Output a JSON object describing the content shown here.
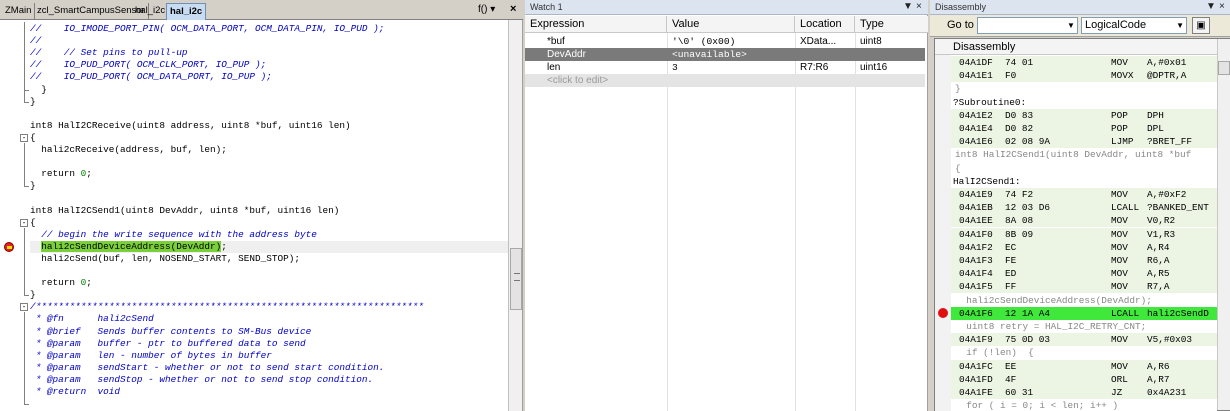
{
  "editor": {
    "tabs": [
      "ZMain",
      "zcl_SmartCampusSensor",
      "hal_i2c",
      "hal_i2c"
    ],
    "active_tab_index": 3,
    "func_button": "f()",
    "close": "×",
    "lines": [
      {
        "text": "//    IO_IMODE_PORT_PIN( OCM_DATA_PORT, OCM_DATA_PIN, IO_PUD );",
        "style": "comment"
      },
      {
        "text": "//",
        "style": "comment"
      },
      {
        "text": "//    // Set pins to pull-up",
        "style": "comment"
      },
      {
        "text": "//    IO_PUD_PORT( OCM_CLK_PORT, IO_PUP );",
        "style": "comment"
      },
      {
        "text": "//    IO_PUD_PORT( OCM_DATA_PORT, IO_PUP );",
        "style": "comment"
      },
      {
        "text": "  }",
        "style": "code"
      },
      {
        "text": "}",
        "style": "code"
      },
      {
        "text": "",
        "style": "code"
      },
      {
        "text": "int8 HalI2CReceive(uint8 address, uint8 *buf, uint16 len)",
        "style": "code"
      },
      {
        "text": "{",
        "style": "code"
      },
      {
        "text": "  hali2cReceive(address, buf, len);",
        "style": "code"
      },
      {
        "text": "",
        "style": "code"
      },
      {
        "text": "  return 0;",
        "style": "ret"
      },
      {
        "text": "}",
        "style": "code"
      },
      {
        "text": "",
        "style": "code"
      },
      {
        "text": "int8 HalI2CSend1(uint8 DevAddr, uint8 *buf, uint16 len)",
        "style": "code"
      },
      {
        "text": "{",
        "style": "code"
      },
      {
        "text": "  // begin the write sequence with the address byte",
        "style": "comment"
      },
      {
        "text": "  hali2cSendDeviceAddress(DevAddr);",
        "style": "highlight"
      },
      {
        "text": "  hali2cSend(buf, len, NOSEND_START, SEND_STOP);",
        "style": "code"
      },
      {
        "text": "",
        "style": "code"
      },
      {
        "text": "  return 0;",
        "style": "ret"
      },
      {
        "text": "}",
        "style": "code"
      },
      {
        "text": "/*********************************************************************",
        "style": "comment"
      },
      {
        "text": " * @fn      hali2cSend",
        "style": "comment"
      },
      {
        "text": " * @brief   Sends buffer contents to SM-Bus device",
        "style": "comment"
      },
      {
        "text": " * @param   buffer - ptr to buffered data to send",
        "style": "comment"
      },
      {
        "text": " * @param   len - number of bytes in buffer",
        "style": "comment"
      },
      {
        "text": " * @param   sendStart - whether or not to send start condition.",
        "style": "comment"
      },
      {
        "text": " * @param   sendStop - whether or not to send stop condition.",
        "style": "comment"
      },
      {
        "text": " * @return  void",
        "style": "comment"
      }
    ]
  },
  "watch": {
    "title": "Watch 1",
    "pin": "▼",
    "close": "×",
    "columns": [
      "Expression",
      "Value",
      "Location",
      "Type"
    ],
    "rows": [
      {
        "expr": "*buf",
        "value": "'\\0' (0x00)",
        "location": "XData...",
        "type": "uint8",
        "state": "normal"
      },
      {
        "expr": "DevAddr",
        "value": "<unavailable>",
        "location": "",
        "type": "",
        "state": "selected"
      },
      {
        "expr": "len",
        "value": "3",
        "location": "R7:R6",
        "type": "uint16",
        "state": "normal"
      },
      {
        "expr": "<click to edit>",
        "value": "",
        "location": "",
        "type": "",
        "state": "add"
      }
    ]
  },
  "disassembly": {
    "title": "Disassembly",
    "pin": "▼",
    "close": "×",
    "goto_label": "Go to",
    "goto_value": "",
    "mode": "LogicalCode",
    "header": "Disassembly",
    "lines": [
      {
        "kind": "asm",
        "addr": "04A1DF",
        "bytes": "74 01",
        "op": "MOV",
        "args": "A,#0x01"
      },
      {
        "kind": "asm",
        "addr": "04A1E1",
        "bytes": "F0",
        "op": "MOVX",
        "args": "@DPTR,A"
      },
      {
        "kind": "src",
        "text": "}"
      },
      {
        "kind": "lbl",
        "text": "?Subroutine0:"
      },
      {
        "kind": "asm",
        "addr": "04A1E2",
        "bytes": "D0 83",
        "op": "POP",
        "args": "DPH"
      },
      {
        "kind": "asm",
        "addr": "04A1E4",
        "bytes": "D0 82",
        "op": "POP",
        "args": "DPL"
      },
      {
        "kind": "asm",
        "addr": "04A1E6",
        "bytes": "02 08 9A",
        "op": "LJMP",
        "args": "?BRET_FF"
      },
      {
        "kind": "src",
        "text": "int8 HalI2CSend1(uint8 DevAddr, uint8 *buf"
      },
      {
        "kind": "src",
        "text": "{"
      },
      {
        "kind": "lbl",
        "text": "HalI2CSend1:"
      },
      {
        "kind": "asm",
        "addr": "04A1E9",
        "bytes": "74 F2",
        "op": "MOV",
        "args": "A,#0xF2"
      },
      {
        "kind": "asm",
        "addr": "04A1EB",
        "bytes": "12 03 D6",
        "op": "LCALL",
        "args": "?BANKED_ENT"
      },
      {
        "kind": "asm",
        "addr": "04A1EE",
        "bytes": "8A 08",
        "op": "MOV",
        "args": "V0,R2"
      },
      {
        "kind": "asm",
        "addr": "04A1F0",
        "bytes": "8B 09",
        "op": "MOV",
        "args": "V1,R3"
      },
      {
        "kind": "asm",
        "addr": "04A1F2",
        "bytes": "EC",
        "op": "MOV",
        "args": "A,R4"
      },
      {
        "kind": "asm",
        "addr": "04A1F3",
        "bytes": "FE",
        "op": "MOV",
        "args": "R6,A"
      },
      {
        "kind": "asm",
        "addr": "04A1F4",
        "bytes": "ED",
        "op": "MOV",
        "args": "A,R5"
      },
      {
        "kind": "asm",
        "addr": "04A1F5",
        "bytes": "FF",
        "op": "MOV",
        "args": "R7,A"
      },
      {
        "kind": "src",
        "text": "  hali2cSendDeviceAddress(DevAddr);"
      },
      {
        "kind": "cur",
        "addr": "04A1F6",
        "bytes": "12 1A A4",
        "op": "LCALL",
        "args": "hali2cSendD"
      },
      {
        "kind": "src",
        "text": "  uint8 retry = HAL_I2C_RETRY_CNT;"
      },
      {
        "kind": "asm",
        "addr": "04A1F9",
        "bytes": "75 0D 03",
        "op": "MOV",
        "args": "V5,#0x03"
      },
      {
        "kind": "src",
        "text": "  if (!len)  {"
      },
      {
        "kind": "asm",
        "addr": "04A1FC",
        "bytes": "EE",
        "op": "MOV",
        "args": "A,R6"
      },
      {
        "kind": "asm",
        "addr": "04A1FD",
        "bytes": "4F",
        "op": "ORL",
        "args": "A,R7"
      },
      {
        "kind": "asm",
        "addr": "04A1FE",
        "bytes": "60 31",
        "op": "JZ",
        "args": "0x4A231"
      },
      {
        "kind": "src",
        "text": "  for ( i = 0; i < len; i++ )"
      }
    ]
  }
}
